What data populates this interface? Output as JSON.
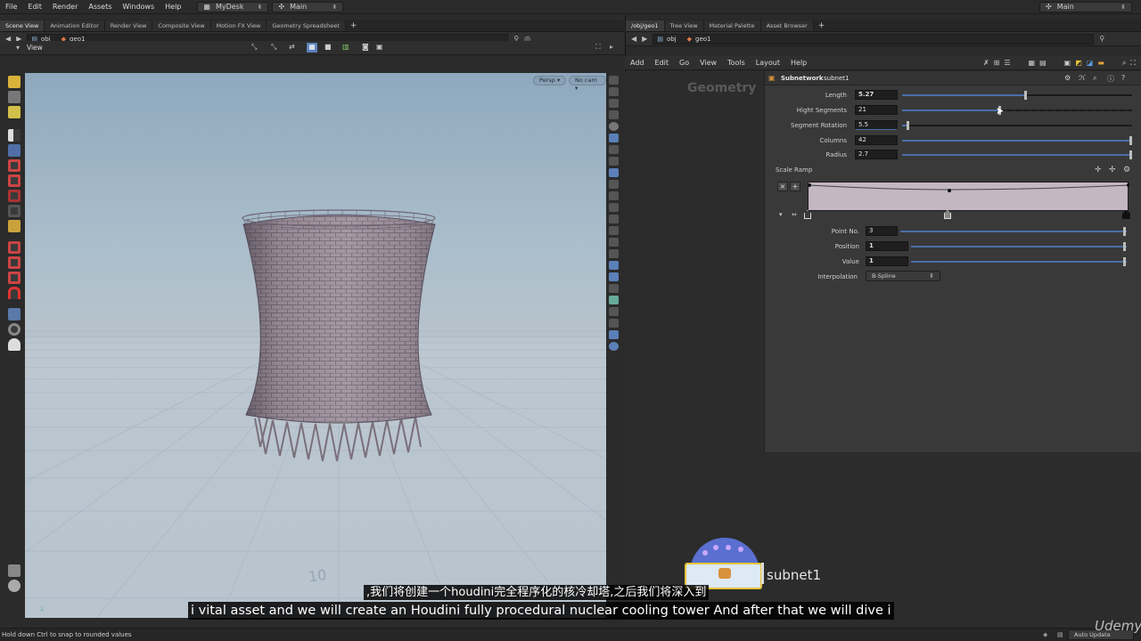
{
  "menubar": {
    "items": [
      "File",
      "Edit",
      "Render",
      "Assets",
      "Windows",
      "Help"
    ],
    "desktop": "MyDesk",
    "context": "Main",
    "right_context": "Main"
  },
  "left_panel": {
    "tabs": [
      "Scene View",
      "Animation Editor",
      "Render View",
      "Composite View",
      "Motion FX View",
      "Geometry Spreadsheet"
    ],
    "path": [
      "obj",
      "geo1"
    ],
    "view_label": "View",
    "persp": "Persp",
    "cam": "No cam",
    "grid_number": "10"
  },
  "right_panel": {
    "tabs": [
      "/obj/geo1",
      "Tree View",
      "Material Palette",
      "Asset Browser"
    ],
    "path": [
      "obj",
      "geo1"
    ],
    "menu": [
      "Add",
      "Edit",
      "Go",
      "View",
      "Tools",
      "Layout",
      "Help"
    ],
    "network_label": "Geometry",
    "node_label": "subnet1",
    "node_type": "Subnetwork",
    "node_name": "subnet1"
  },
  "params": {
    "length": {
      "label": "Length",
      "value": "5.27",
      "level": 0.53
    },
    "hight_segments": {
      "label": "Hight Segments",
      "value": "21",
      "level": 0.42
    },
    "segment_rotation": {
      "label": "Segment Rotation",
      "value": "5.5",
      "level": 0.02
    },
    "columns": {
      "label": "Columns",
      "value": "42",
      "level": 1.0
    },
    "radius": {
      "label": "Radius",
      "value": "2.7",
      "level": 1.0
    },
    "scale_ramp": "Scale Ramp",
    "point_no": {
      "label": "Point No.",
      "value": "3"
    },
    "position": {
      "label": "Position",
      "value": "1"
    },
    "value": {
      "label": "Value",
      "value": "1"
    },
    "interpolation": {
      "label": "Interpolation",
      "value": "B-Spline"
    }
  },
  "subtitles": {
    "chinese": ",我们将创建一个houdini完全程序化的核冷却塔,之后我们将深入到",
    "english": "i vital asset and we will create an Houdini fully procedural nuclear cooling tower  And after that we will dive i"
  },
  "status": {
    "hint": "Hold down Ctrl to snap to rounded values",
    "auto_update": "Auto Update",
    "watermark": "Udemy"
  },
  "colors": {
    "tower": "#9a8c97",
    "sky": "#8fa8bd",
    "accent": "#4a6fa8",
    "node_blue": "#3c5fd0"
  }
}
